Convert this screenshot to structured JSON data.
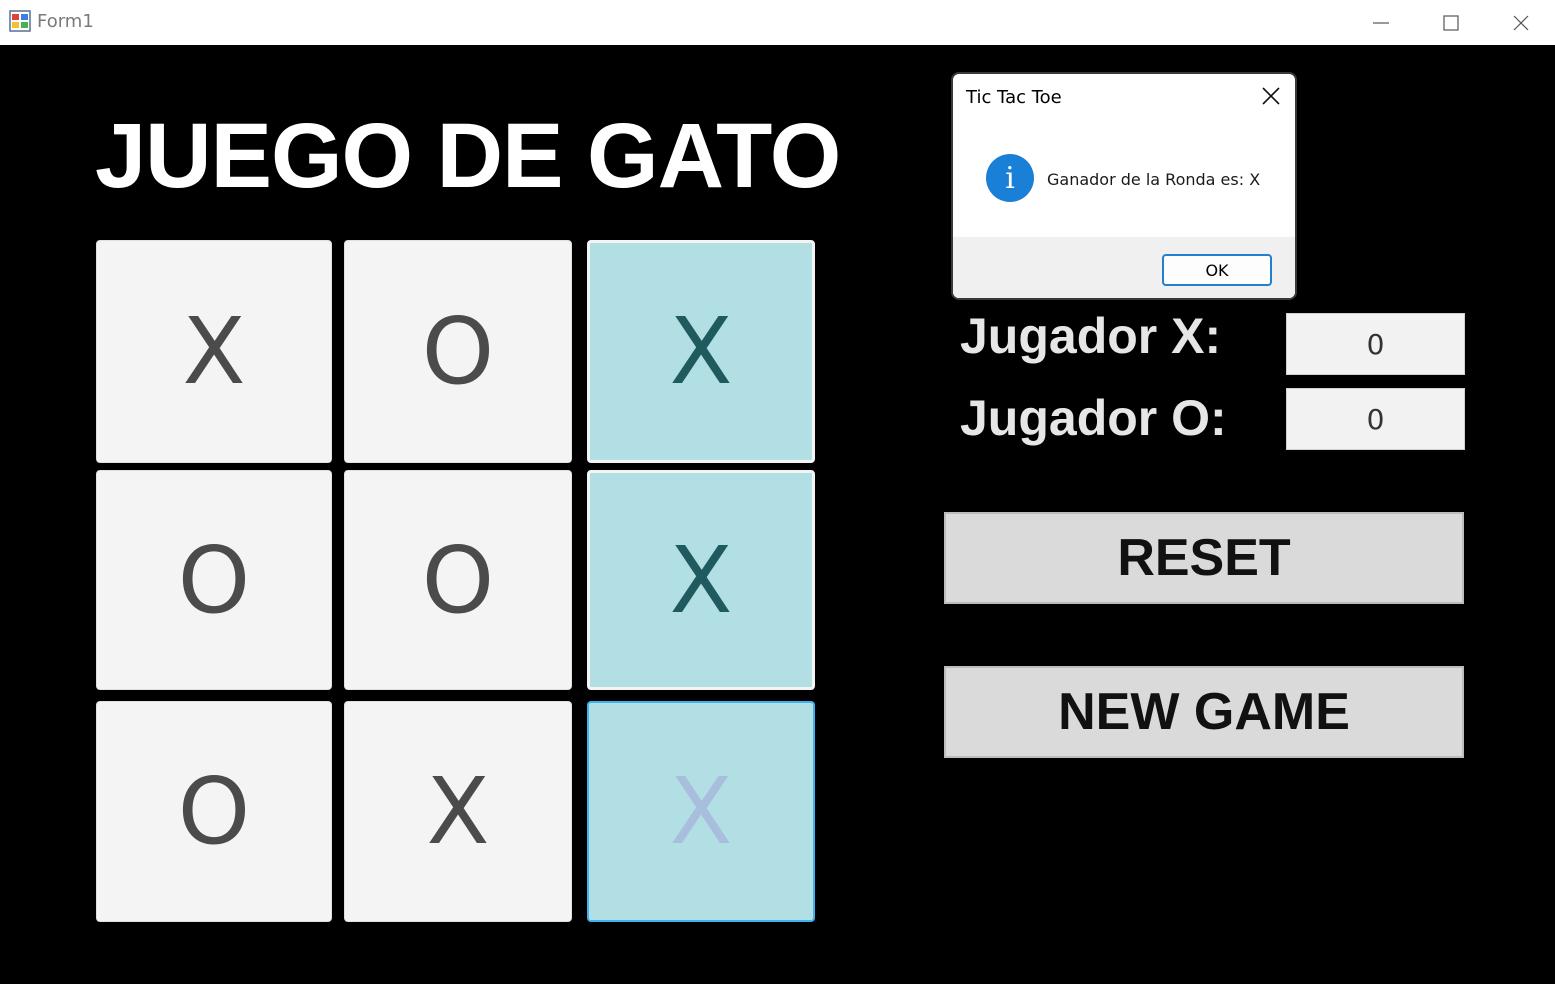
{
  "window": {
    "title": "Form1",
    "icon": "winforms-app-icon"
  },
  "game": {
    "heading": "JUEGO DE GATO",
    "board": [
      [
        "X",
        "O",
        "X"
      ],
      [
        "O",
        "O",
        "X"
      ],
      [
        "O",
        "X",
        "X"
      ]
    ],
    "winning_column": 3,
    "colors": {
      "cell": "#f4f4f4",
      "winning_cell": "#b2dfe4",
      "background": "#000000"
    }
  },
  "scores": {
    "player_x_label": "Jugador X:",
    "player_x_value": "0",
    "player_o_label": "Jugador O:",
    "player_o_value": "0"
  },
  "buttons": {
    "reset": "RESET",
    "new_game": "NEW GAME"
  },
  "dialog": {
    "title": "Tic Tac Toe",
    "icon": "info-icon",
    "message": "Ganador de la Ronda es: X",
    "ok": "OK"
  }
}
